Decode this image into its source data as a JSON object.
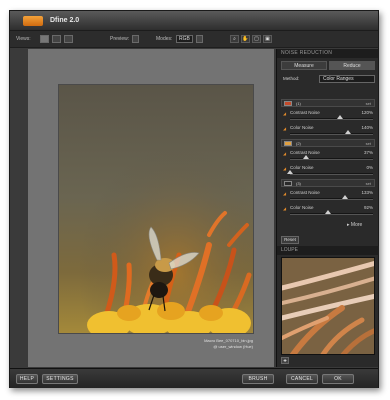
{
  "app": {
    "title": "Dfine 2.0"
  },
  "toolbar": {
    "views_label": "Views:",
    "preview_label": "Preview:",
    "modes_label": "Modes:",
    "mode_value": "RGB"
  },
  "image": {
    "caption_line1": "Macro Bee_070710_bin.jpg",
    "caption_line2": "@ user_window (Hue)"
  },
  "panel": {
    "title": "NOISE REDUCTION",
    "tabs": [
      {
        "label": "Measure"
      },
      {
        "label": "Reduce"
      }
    ],
    "method_label": "Method:",
    "method_value": "Color Ranges",
    "groups": [
      {
        "color": "#c44a2a",
        "tag": "(1)",
        "eye": "set",
        "sliders": [
          {
            "label": "Contrast Noise",
            "value": "120%",
            "fraction": 0.6
          },
          {
            "label": "Color Noise",
            "value": "140%",
            "fraction": 0.7
          }
        ]
      },
      {
        "color": "#e0a040",
        "tag": "(2)",
        "eye": "set",
        "sliders": [
          {
            "label": "Contrast Noise",
            "value": "37%",
            "fraction": 0.19
          },
          {
            "label": "Color Noise",
            "value": "0%",
            "fraction": 0.0
          }
        ]
      },
      {
        "color": "#2a2a2a",
        "tag": "(3)",
        "eye": "set",
        "sliders": [
          {
            "label": "Contrast Noise",
            "value": "133%",
            "fraction": 0.66
          },
          {
            "label": "Color Noise",
            "value": "92%",
            "fraction": 0.46
          }
        ]
      }
    ],
    "more_label": "More",
    "reset_label": "Reset",
    "loupe_title": "LOUPE"
  },
  "bottom": {
    "help_label": "HELP",
    "settings_label": "SETTINGS",
    "brush_label": "BRUSH",
    "cancel_label": "CANCEL",
    "ok_label": "OK"
  },
  "icons": [
    "logo-icon",
    "view-single-icon",
    "view-split-icon",
    "view-side-icon",
    "zoom-icon",
    "hand-icon",
    "crop-icon",
    "pin-icon"
  ]
}
